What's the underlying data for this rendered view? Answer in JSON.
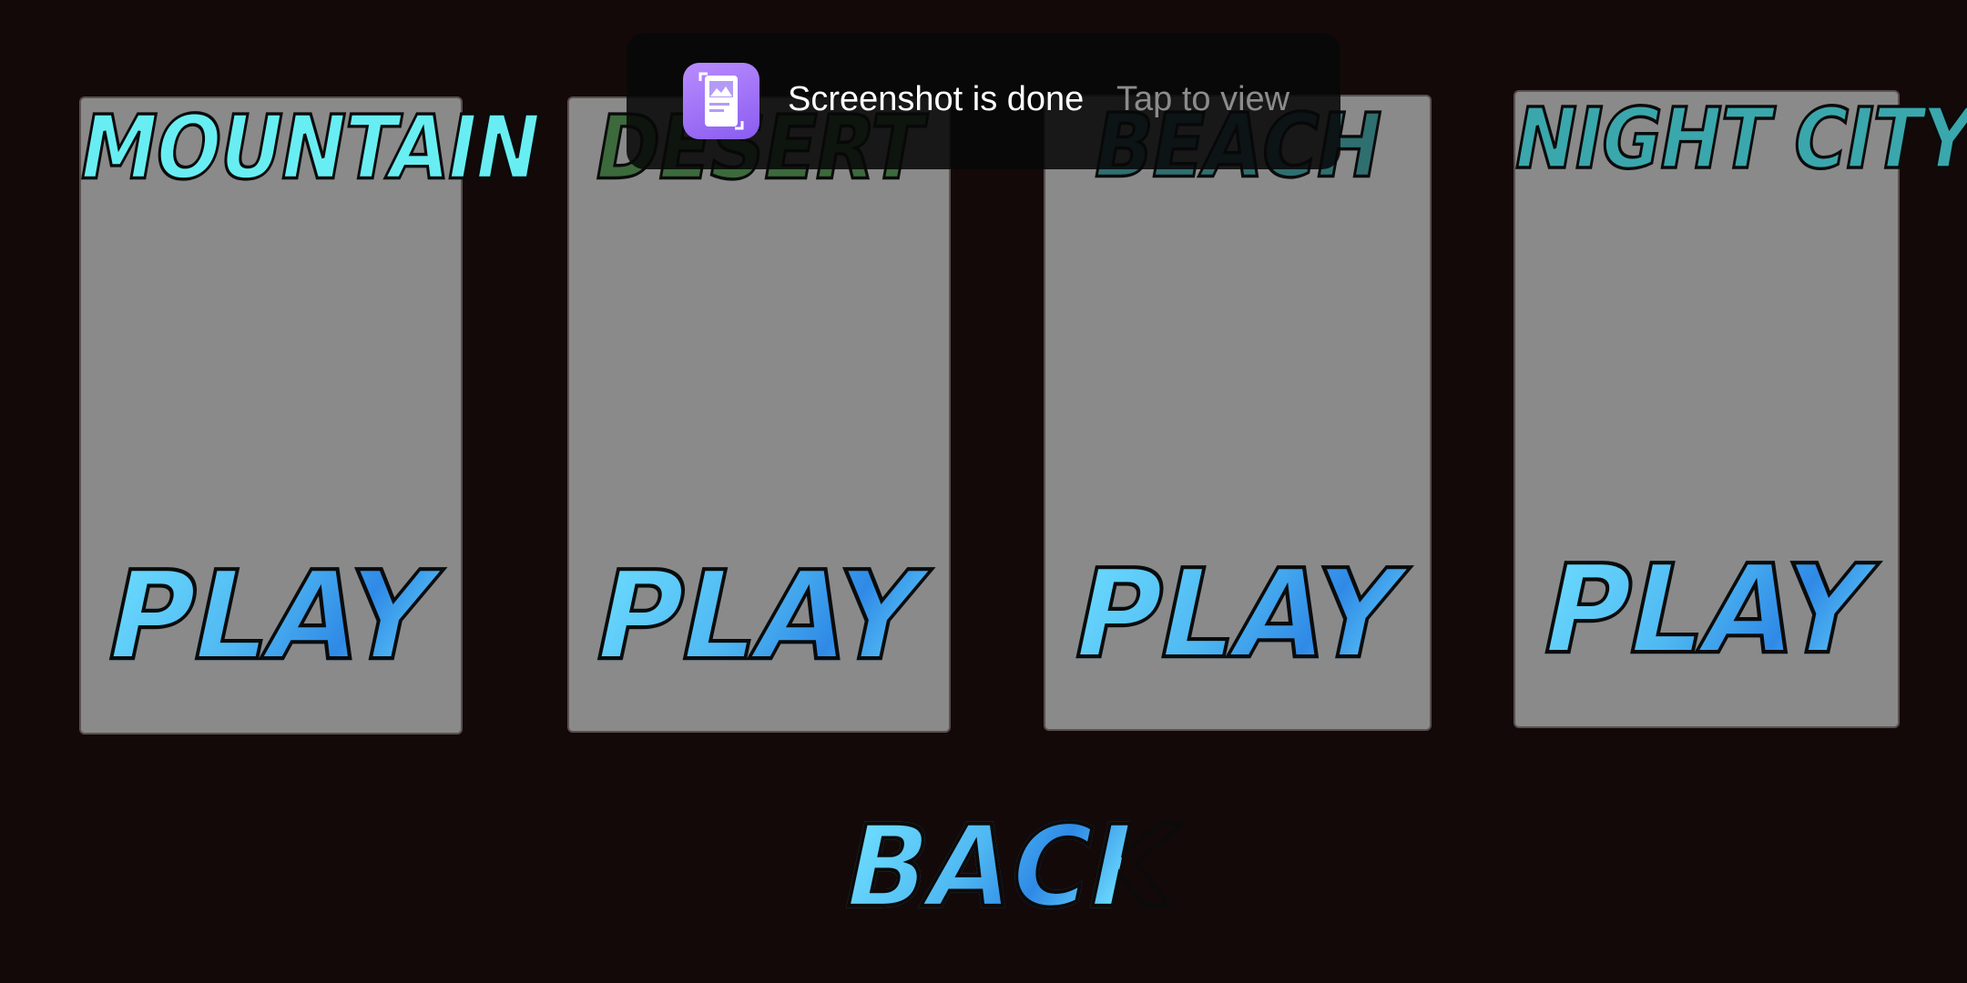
{
  "levels": [
    {
      "title": "MOUNTAIN",
      "title_color": "#68eef2",
      "play_label": "PLAY"
    },
    {
      "title": "DESERT",
      "title_color": "#3c6a3c",
      "play_label": "PLAY"
    },
    {
      "title": "BEACH",
      "title_color": "#2f6f70",
      "play_label": "PLAY"
    },
    {
      "title": "NIGHT CITY",
      "title_color": "#3aa7ac",
      "play_label": "PLAY"
    }
  ],
  "back_label": "BACK",
  "toast": {
    "icon": "screenshot-icon",
    "message": "Screenshot is done",
    "action": "Tap to view"
  },
  "colors": {
    "background": "#140909",
    "card": "#8a8a8a",
    "button_gradient_light": "#6fe0ff",
    "button_gradient_dark": "#2f8ae6",
    "toast_icon": "#9b6cf6"
  }
}
